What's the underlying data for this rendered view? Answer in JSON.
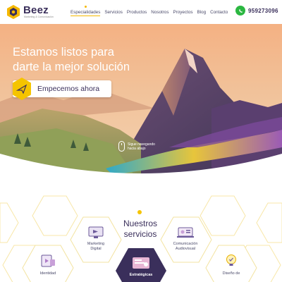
{
  "header": {
    "brand": "Beez",
    "tagline": "Marketing & Comunicación",
    "nav": [
      {
        "label": "Especialidades",
        "active": true
      },
      {
        "label": "Servicios"
      },
      {
        "label": "Productos"
      },
      {
        "label": "Nosotros"
      },
      {
        "label": "Proyectos"
      },
      {
        "label": "Blog"
      },
      {
        "label": "Contacto"
      }
    ],
    "phone": "959273096",
    "phone_icon": "whatsapp-icon"
  },
  "hero": {
    "title_line1": "Estamos listos para",
    "title_line2": "darte la mejor solución",
    "cta": "Empecemos ahora",
    "scroll_line1": "Sigue navegando",
    "scroll_line2": "hacia abajo"
  },
  "services": {
    "heading_line1": "Nuestros",
    "heading_line2": "servicios",
    "items": [
      {
        "line1": "Marketing",
        "line2": "Digital",
        "icon": "marketing-icon"
      },
      {
        "line1": "Comunicación",
        "line2": "Audiovisual",
        "icon": "video-icon"
      },
      {
        "line1": "Identidad",
        "line2": "",
        "icon": "identity-icon"
      },
      {
        "line1": "Estratégicas",
        "line2": "",
        "icon": "strategy-icon"
      },
      {
        "line1": "Diseño de",
        "line2": "",
        "icon": "bulb-icon"
      }
    ]
  },
  "colors": {
    "brand_dark": "#3a2f5b",
    "accent": "#f5b800",
    "whatsapp": "#2bb741"
  }
}
